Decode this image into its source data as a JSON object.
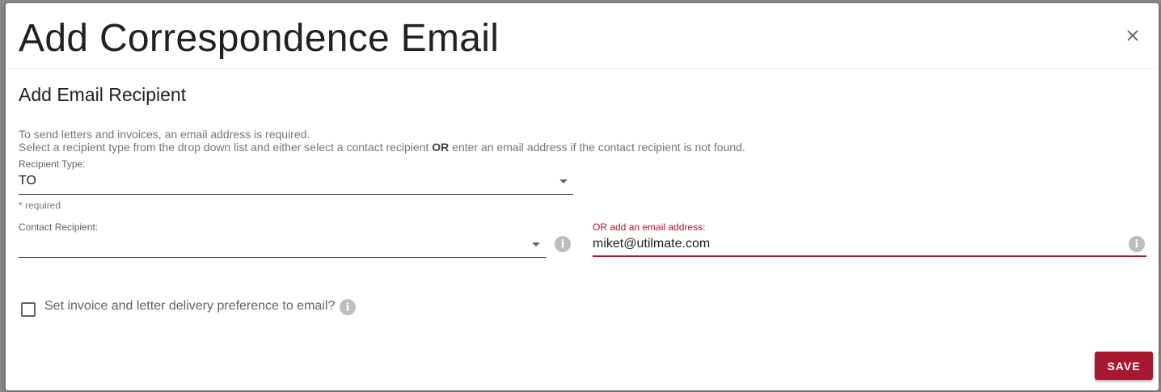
{
  "dialog": {
    "title": "Add Correspondence Email",
    "section_title": "Add Email Recipient",
    "info_line1": "To send letters and invoices, an email address is required.",
    "info_line2_pre": "Select a recipient type from the drop down list and either select a contact recipient ",
    "info_line2_bold": "OR",
    "info_line2_post": " enter an email address if the contact recipient is not found."
  },
  "recipient_type": {
    "label": "Recipient Type:",
    "value": "TO",
    "hint": "* required"
  },
  "contact_recipient": {
    "label": "Contact Recipient:",
    "value": ""
  },
  "email_address": {
    "label": "OR add an email address:",
    "value": "miket@utilmate.com"
  },
  "delivery_preference": {
    "label": "Set invoice and letter delivery preference to email?",
    "checked": false
  },
  "actions": {
    "save_label": "SAVE"
  },
  "colors": {
    "accent": "#a8172f",
    "overlay": "#8a8a8a"
  },
  "icons": {
    "close": "close-icon",
    "info": "info-icon",
    "dropdown": "chevron-down-icon"
  }
}
